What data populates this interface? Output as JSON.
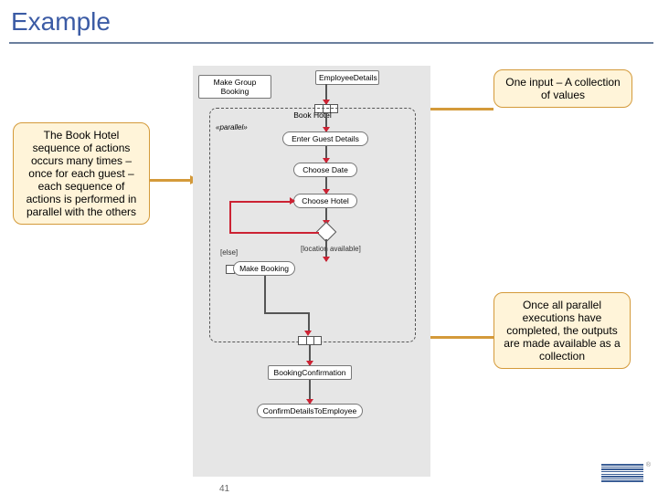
{
  "title": "Example",
  "page_number": "41",
  "callouts": {
    "top_right": "One input – A collection of values",
    "left": "The Book Hotel sequence of actions occurs many times – once for each guest – each sequence of actions is performed in parallel with the others",
    "bottom_right": "Once all parallel executions have completed, the outputs are made available as a collection"
  },
  "diagram": {
    "make_group_booking": "Make Group Booking",
    "employee_details": "EmployeeDetails",
    "region_title": "Book Hotel",
    "region_keyword": "«parallel»",
    "enter_guest_details": "Enter Guest Details",
    "choose_date": "Choose Date",
    "choose_hotel": "Choose Hotel",
    "else": "[else]",
    "location_available": "[location available]",
    "make_booking": "Make Booking",
    "booking_confirmation": "BookingConfirmation",
    "confirm_details": "ConfirmDetailsToEmployee"
  },
  "brand": "IBM"
}
